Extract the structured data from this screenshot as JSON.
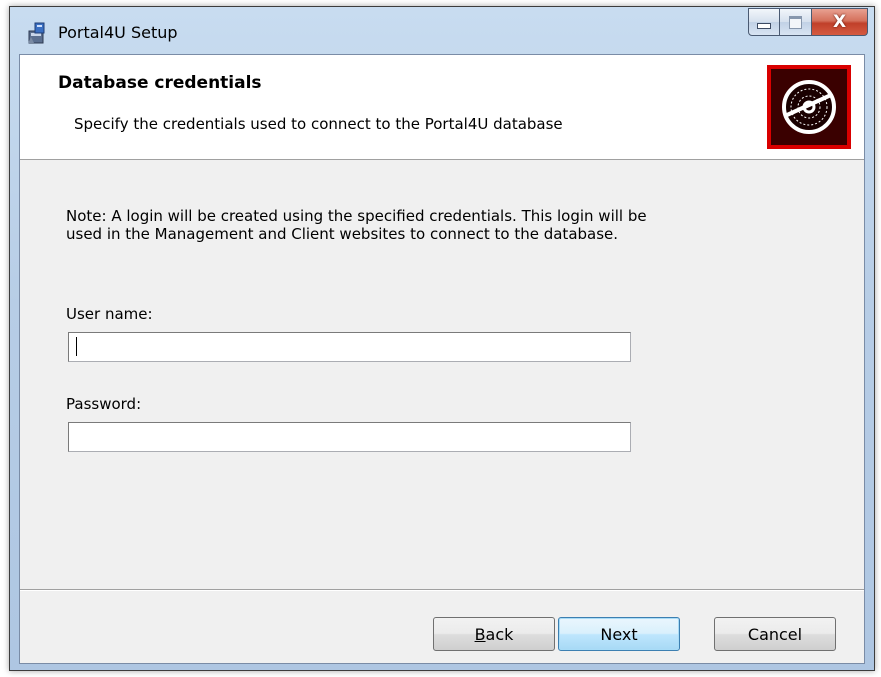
{
  "window": {
    "title": "Portal4U Setup",
    "icon": "installer-icon",
    "caption_buttons": {
      "minimize_icon": "minimize-icon",
      "maximize_icon": "maximize-icon",
      "close_glyph": "X"
    }
  },
  "banner": {
    "title": "Database credentials",
    "subtitle": "Specify the credentials used to connect to the Portal4U database",
    "logo_icon": "disc-icon",
    "logo_color": "#d90000"
  },
  "body": {
    "note": "Note: A login will be created using the specified credentials. This login will be used in the Management and Client websites to connect to the database.",
    "username": {
      "label": "User name:",
      "value": ""
    },
    "password": {
      "label": "Password:",
      "value": ""
    }
  },
  "footer": {
    "back": {
      "mnemonic": "B",
      "rest": "ack"
    },
    "next_label": "Next",
    "cancel_label": "Cancel"
  },
  "colors": {
    "default_button_border": "#3c7fb1",
    "close_button": "#c0402a"
  }
}
